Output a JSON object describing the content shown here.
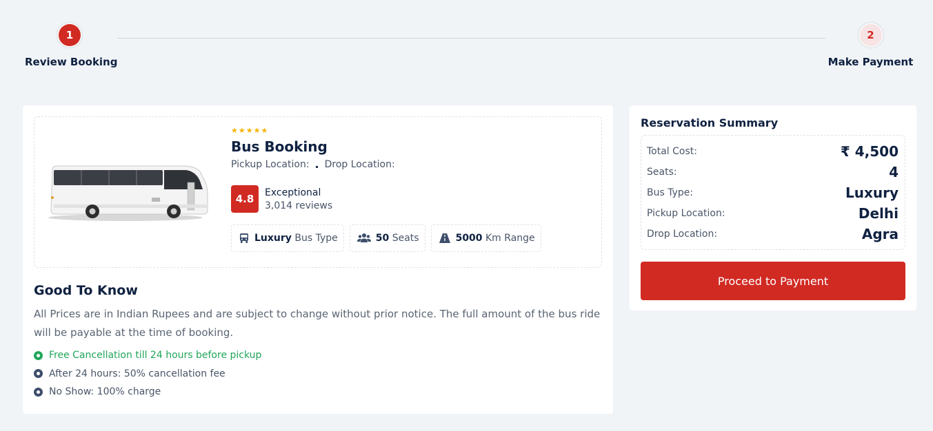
{
  "stepper": {
    "steps": [
      {
        "number": "1",
        "label": "Review Booking"
      },
      {
        "number": "2",
        "label": "Make Payment"
      }
    ]
  },
  "bus": {
    "star_count": 5,
    "title": "Bus Booking",
    "pickup_label": "Pickup Location:",
    "separator": ".",
    "drop_label": "Drop Location:",
    "rating": {
      "score": "4.8",
      "label": "Exceptional",
      "reviews": "3,014 reviews"
    },
    "features": [
      {
        "icon": "bus-icon",
        "value": "Luxury",
        "label": "Bus Type"
      },
      {
        "icon": "users-icon",
        "value": "50",
        "label": "Seats"
      },
      {
        "icon": "road-icon",
        "value": "5000",
        "label": "Km Range"
      }
    ]
  },
  "good_to_know": {
    "title": "Good To Know",
    "description": "All Prices are in Indian Rupees and are subject to change without prior notice. The full amount of the bus ride will be payable at the time of booking.",
    "items": [
      {
        "text": "Free Cancellation till 24 hours before pickup",
        "status": "green"
      },
      {
        "text": "After 24 hours: 50% cancellation fee",
        "status": "navy"
      },
      {
        "text": "No Show: 100% charge",
        "status": "navy"
      }
    ]
  },
  "summary": {
    "title": "Reservation Summary",
    "rows": [
      {
        "label": "Total Cost:",
        "value": "₹ 4,500"
      },
      {
        "label": "Seats:",
        "value": "4"
      },
      {
        "label": "Bus Type:",
        "value": "Luxury"
      },
      {
        "label": "Pickup Location:",
        "value": "Delhi"
      },
      {
        "label": "Drop Location:",
        "value": "Agra"
      }
    ],
    "button_label": "Proceed to Payment"
  },
  "colors": {
    "accent": "#d12a23",
    "navy": "#0f2141",
    "success": "#20a65a",
    "background": "#f1f4f7",
    "star": "#f5b300"
  }
}
